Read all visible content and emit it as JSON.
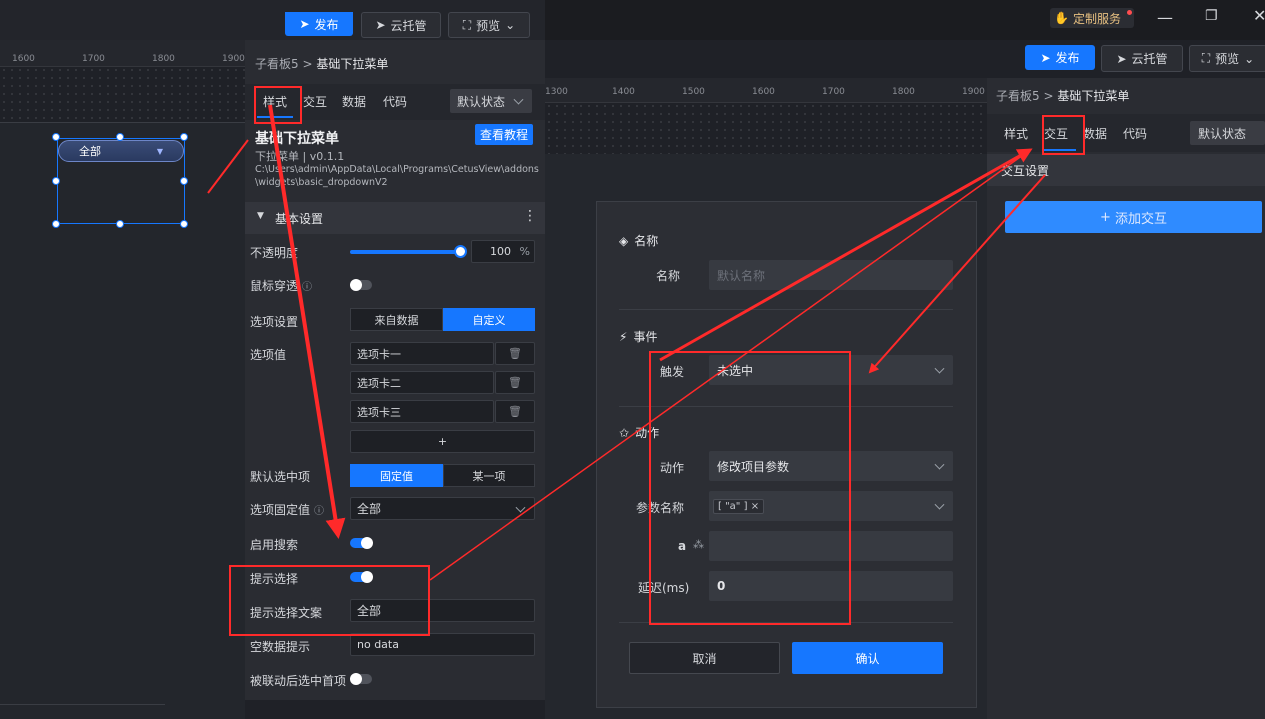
{
  "topbar_left": {
    "publish": "发布",
    "cloud": "云托管",
    "preview": "预览"
  },
  "topbar_right": {
    "custom_service": "定制服务",
    "publish": "发布",
    "cloud": "云托管",
    "preview": "预览"
  },
  "ruler_left": [
    "1600",
    "1700",
    "1800",
    "1900"
  ],
  "ruler_right": [
    "1300",
    "1400",
    "1500",
    "1600",
    "1700",
    "1800",
    "1900"
  ],
  "widget_preview": {
    "value": "全部"
  },
  "left_panel": {
    "breadcrumb_parent": "子看板5",
    "breadcrumb_current": "基础下拉菜单",
    "tabs": [
      "样式",
      "交互",
      "数据",
      "代码"
    ],
    "state": "默认状态",
    "title": "基础下拉菜单",
    "tutorial": "查看教程",
    "subtitle": "下拉菜单 | v0.1.1",
    "path": "C:\\Users\\admin\\AppData\\Local\\Programs\\CetusView\\addons\\widgets\\basic_dropdownV2",
    "section": "基本设置",
    "opacity_label": "不透明度",
    "opacity_value": "100",
    "opacity_unit": "%",
    "opacity_level": 1.0,
    "mouse_through_label": "鼠标穿透",
    "option_setting_label": "选项设置",
    "option_from_data": "来自数据",
    "option_custom": "自定义",
    "option_values_label": "选项值",
    "option_values": [
      "选项卡一",
      "选项卡二",
      "选项卡三"
    ],
    "add_option": "+",
    "default_selected_label": "默认选中项",
    "default_fixed": "固定值",
    "default_item": "某一项",
    "fixed_value_label": "选项固定值",
    "fixed_value": "全部",
    "enable_search_label": "启用搜索",
    "hint_select_label": "提示选择",
    "hint_text_label": "提示选择文案",
    "hint_text_value": "全部",
    "empty_hint_label": "空数据提示",
    "empty_hint_value": "no data",
    "linked_first_label": "被联动后选中首项"
  },
  "right_panel": {
    "breadcrumb_parent": "子看板5",
    "breadcrumb_current": "基础下拉菜单",
    "tabs": [
      "样式",
      "交互",
      "数据",
      "代码"
    ],
    "state": "默认状态",
    "interaction_settings": "交互设置",
    "add_interaction": "添加交互"
  },
  "modal": {
    "name_section": "名称",
    "name_label": "名称",
    "name_placeholder": "默认名称",
    "event_section": "事件",
    "trigger_label": "触发",
    "trigger_value": "未选中",
    "action_section": "动作",
    "action_label": "动作",
    "action_value": "修改项目参数",
    "param_name_label": "参数名称",
    "param_tag": "[ \"a\" ]",
    "param_a_label": "a",
    "delay_label": "延迟(ms)",
    "delay_value": "0",
    "cancel": "取消",
    "confirm": "确认"
  },
  "colors": {
    "accent": "#1677ff",
    "annotation": "#ff2a2a"
  }
}
